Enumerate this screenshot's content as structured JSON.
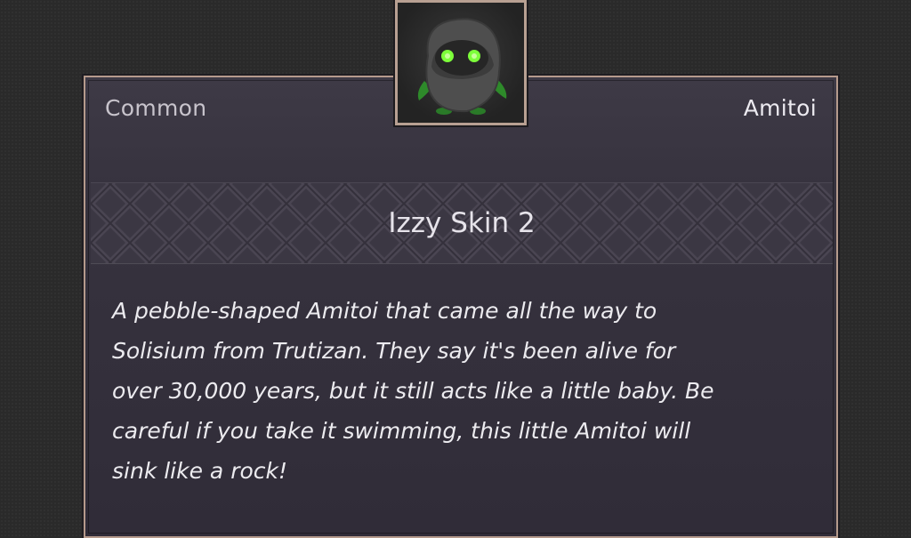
{
  "item": {
    "rarity": "Common",
    "category": "Amitoi",
    "name": "Izzy Skin 2",
    "description": "A pebble-shaped Amitoi that came all the way to\nSolisium from Trutizan. They say it's been alive for\nover 30,000 years, but it still acts like a little baby. Be\ncareful if you take it swimming, this little Amitoi will\nsink like a rock!",
    "portrait_icon": "pebble-amitoi-icon"
  },
  "colors": {
    "frame": "#b59a8c",
    "panel": "#37333f",
    "eye_glow": "#7dff3a"
  }
}
